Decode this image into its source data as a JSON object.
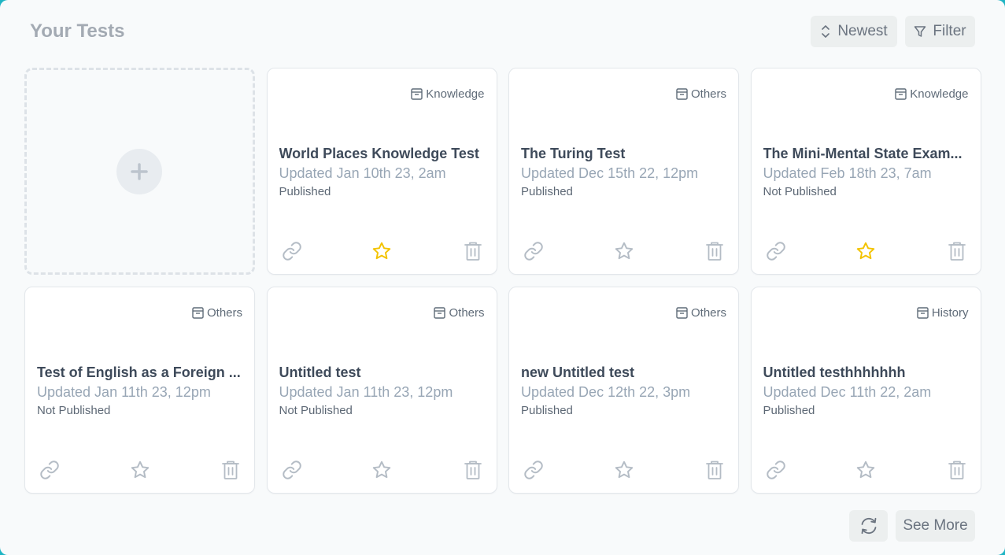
{
  "header": {
    "title": "Your Tests",
    "sort_label": "Newest",
    "filter_label": "Filter"
  },
  "footer": {
    "see_more_label": "See More"
  },
  "colors": {
    "star_active": "#f3c300",
    "icon_muted": "#b4bcc5",
    "category_icon": "#5f6b78"
  },
  "tests": [
    {
      "category": "Knowledge",
      "title": "World Places Knowledge Test",
      "updated": "Updated Jan 10th 23, 2am",
      "status": "Published",
      "starred": true
    },
    {
      "category": "Others",
      "title": "The Turing Test",
      "updated": "Updated Dec 15th 22, 12pm",
      "status": "Published",
      "starred": false
    },
    {
      "category": "Knowledge",
      "title": "The Mini-Mental State Exam...",
      "updated": "Updated Feb 18th 23, 7am",
      "status": "Not Published",
      "starred": true
    },
    {
      "category": "Others",
      "title": "Test of English as a Foreign ...",
      "updated": "Updated Jan 11th 23, 12pm",
      "status": "Not Published",
      "starred": false
    },
    {
      "category": "Others",
      "title": "Untitled test",
      "updated": "Updated Jan 11th 23, 12pm",
      "status": "Not Published",
      "starred": false
    },
    {
      "category": "Others",
      "title": "new Untitled test",
      "updated": "Updated Dec 12th 22, 3pm",
      "status": "Published",
      "starred": false
    },
    {
      "category": "History",
      "title": "Untitled testhhhhhhh",
      "updated": "Updated Dec 11th 22, 2am",
      "status": "Published",
      "starred": false
    }
  ]
}
